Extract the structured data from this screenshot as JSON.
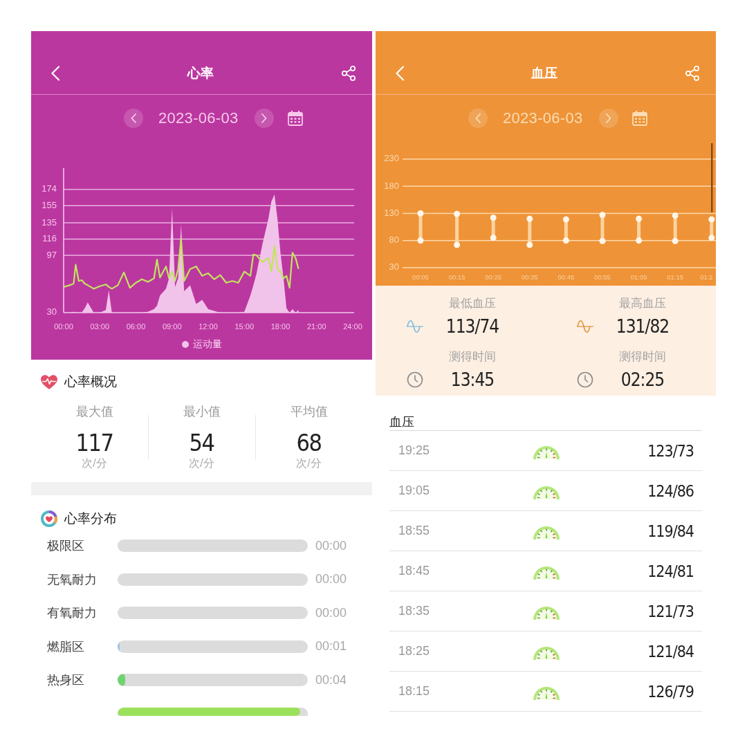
{
  "heart_rate_screen": {
    "header": {
      "title": "心率"
    },
    "date_nav": {
      "date": "2023-06-03"
    },
    "chart_data": {
      "type": "line",
      "grid": true,
      "x": [
        0,
        0.5,
        0.83,
        1,
        1.25,
        1.5,
        1.75,
        2,
        2.5,
        3,
        3.5,
        3.75,
        4,
        4.5,
        5,
        5.5,
        6,
        6.5,
        7,
        7.5,
        7.75,
        8,
        8.5,
        8.75,
        9,
        9.25,
        9.5,
        9.75,
        10,
        10.5,
        11,
        11.5,
        12,
        12.5,
        13,
        13.5,
        14,
        14.5,
        15,
        15.5,
        15.75,
        16,
        16.5,
        17,
        17.25,
        17.5,
        17.75,
        18,
        18.25,
        18.5,
        18.75,
        19,
        19.25,
        19.5
      ],
      "xlim": [
        0,
        24
      ],
      "ylim": [
        30,
        199
      ],
      "xticks": [
        {
          "value": 0,
          "label": "00:00"
        },
        {
          "value": 3,
          "label": "03:00"
        },
        {
          "value": 6,
          "label": "06:00"
        },
        {
          "value": 9,
          "label": "09:00"
        },
        {
          "value": 12,
          "label": "12:00"
        },
        {
          "value": 15,
          "label": "15:00"
        },
        {
          "value": 18,
          "label": "18:00"
        },
        {
          "value": 21,
          "label": "21:00"
        },
        {
          "value": 24,
          "label": "24:00"
        }
      ],
      "yticks": [
        30,
        97,
        116,
        135,
        155,
        174
      ],
      "series": [
        {
          "type": "area",
          "name": "运动量",
          "color": "#f2c3ea",
          "values": [
            30,
            30,
            31,
            30,
            30,
            30,
            35,
            42,
            30,
            30,
            33,
            56,
            30,
            30,
            30,
            30,
            30,
            30,
            31,
            34,
            38,
            50,
            58,
            70,
            152,
            60,
            70,
            133,
            55,
            62,
            40,
            45,
            34,
            32,
            30,
            30,
            30,
            30,
            31,
            50,
            62,
            75,
            110,
            140,
            160,
            168,
            140,
            100,
            70,
            35,
            30,
            34,
            30,
            33
          ]
        },
        {
          "type": "line",
          "color": "#c2e55e",
          "values": [
            60,
            62,
            64,
            86,
            67,
            68,
            64,
            62,
            58,
            61,
            63,
            60,
            58,
            62,
            77,
            59,
            65,
            69,
            66,
            70,
            92,
            71,
            84,
            70,
            78,
            67,
            81,
            116,
            67,
            81,
            84,
            73,
            76,
            69,
            74,
            65,
            67,
            65,
            78,
            73,
            98,
            97,
            89,
            94,
            78,
            108,
            81,
            78,
            70,
            73,
            59,
            100,
            94,
            81
          ]
        }
      ]
    },
    "overview": {
      "title": "心率概况",
      "stats": [
        {
          "label": "最大值",
          "value": "117",
          "unit": "次/分"
        },
        {
          "label": "最小值",
          "value": "54",
          "unit": "次/分"
        },
        {
          "label": "平均值",
          "value": "68",
          "unit": "次/分"
        }
      ]
    },
    "distribution": {
      "title": "心率分布",
      "zones": [
        {
          "label": "极限区",
          "time": "00:00"
        },
        {
          "label": "无氧耐力",
          "time": "00:00"
        },
        {
          "label": "有氧耐力",
          "time": "00:00"
        },
        {
          "label": "燃脂区",
          "level": 0.01,
          "color": "#9ec4e8",
          "time": "00:01"
        },
        {
          "label": "热身区",
          "level": 0.04,
          "color": "#6fd46f",
          "time": "00:04"
        },
        {
          "level": 0.96,
          "color": "#9be05a"
        }
      ]
    }
  },
  "blood_pressure_screen": {
    "header": {
      "title": "血压"
    },
    "date_nav": {
      "date": "2023-06-03"
    },
    "chart_data": {
      "type": "scatter",
      "grid": true,
      "categories": [
        "00:05",
        "00:15",
        "00:25",
        "00:35",
        "00:45",
        "00:55",
        "01:05",
        "01:15",
        "01:2"
      ],
      "ylim": [
        30,
        230
      ],
      "yticks": [
        30,
        80,
        130,
        180,
        230
      ],
      "series": [
        {
          "values": [
            130,
            129,
            122,
            120,
            119,
            127,
            120,
            126,
            119
          ]
        },
        {
          "values": [
            80,
            72,
            85,
            72,
            80,
            79,
            80,
            79,
            85
          ]
        }
      ]
    },
    "summary": [
      {
        "label": "最低血压",
        "value": "113/74",
        "color": "#7ab8e0",
        "time_label": "测得时间",
        "time": "13:45"
      },
      {
        "label": "最高血压",
        "value": "131/82",
        "color": "#e0913a",
        "time_label": "测得时间",
        "time": "02:25"
      }
    ],
    "records": {
      "title": "血压",
      "rows": [
        {
          "time": "19:25",
          "reading": "123/73"
        },
        {
          "time": "19:05",
          "reading": "124/86"
        },
        {
          "time": "18:55",
          "reading": "119/84"
        },
        {
          "time": "18:45",
          "reading": "124/81"
        },
        {
          "time": "18:35",
          "reading": "121/73"
        },
        {
          "time": "18:25",
          "reading": "121/84"
        },
        {
          "time": "18:15",
          "reading": "126/79"
        }
      ]
    }
  }
}
